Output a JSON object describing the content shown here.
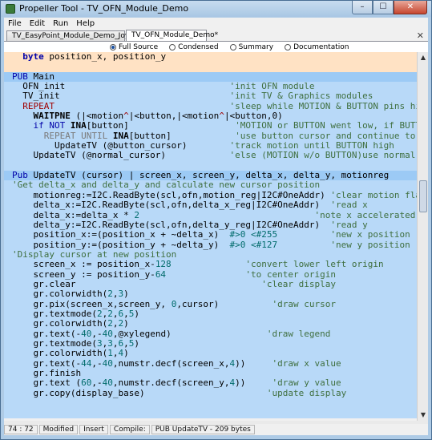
{
  "window": {
    "title": "Propeller Tool - TV_OFN_Module_Demo"
  },
  "caption_buttons": {
    "minimize": "–",
    "maximize": "☐",
    "close": "✕"
  },
  "menu": [
    "File",
    "Edit",
    "Run",
    "Help"
  ],
  "tabs": [
    {
      "label": "TV_EasyPoint_Module_Demo_Joystick"
    },
    {
      "label": "TV_OFN_Module_Demo*"
    }
  ],
  "tab_close": "✕",
  "view_modes": [
    "Full Source",
    "Condensed",
    "Summary",
    "Documentation"
  ],
  "selected_view": "Full Source",
  "code": [
    {
      "bg": "var",
      "parts": [
        [
          "",
          "  "
        ],
        [
          "kw bold",
          "byte"
        ],
        [
          "",
          " position_x, position_y"
        ]
      ]
    },
    {
      "bg": "var",
      "parts": [
        [
          "",
          ""
        ]
      ]
    },
    {
      "bg": "pubh",
      "parts": [
        [
          "kw",
          "PUB"
        ],
        [
          "",
          " Main"
        ]
      ]
    },
    {
      "bg": "pub",
      "parts": [
        [
          "",
          "  OFN_init                               "
        ],
        [
          "c",
          "'init OFN module"
        ]
      ]
    },
    {
      "bg": "pub",
      "parts": [
        [
          "",
          "  TV_init                                "
        ],
        [
          "c",
          "'init TV & Graphics modules"
        ]
      ]
    },
    {
      "bg": "pub",
      "parts": [
        [
          "rd",
          "  REPEAT"
        ],
        [
          "",
          "                                 "
        ],
        [
          "c",
          "'sleep while MOTION & BUTTON pins high"
        ]
      ]
    },
    {
      "bg": "pub",
      "parts": [
        [
          "",
          "    "
        ],
        [
          "bold",
          "WAITPNE"
        ],
        [
          "",
          " (|<motion"
        ],
        [
          "rd",
          "^"
        ],
        [
          "",
          "|<button,|<motion"
        ],
        [
          "rd",
          "^"
        ],
        [
          "",
          "|<button,0)"
        ]
      ]
    },
    {
      "bg": "pub",
      "parts": [
        [
          "",
          "    "
        ],
        [
          "kw",
          "if NOT"
        ],
        [
          "",
          " "
        ],
        [
          "bold",
          "INA"
        ],
        [
          "",
          "[button]                    "
        ],
        [
          "c",
          "'MOTION or BUTTON went low, if BUTTON,"
        ]
      ]
    },
    {
      "bg": "pub",
      "parts": [
        [
          "",
          "      "
        ],
        [
          "gray",
          "REPEAT UNTIL"
        ],
        [
          "",
          " "
        ],
        [
          "bold",
          "INA"
        ],
        [
          "",
          "[button]            "
        ],
        [
          "c",
          "'use button cursor and continue to"
        ]
      ]
    },
    {
      "bg": "pub",
      "parts": [
        [
          "",
          "        UpdateTV (@button_cursor)        "
        ],
        [
          "c",
          "'track motion until BUTTON high"
        ]
      ]
    },
    {
      "bg": "pub",
      "parts": [
        [
          "",
          "    UpdateTV (@normal_cursor)            "
        ],
        [
          "c",
          "'else (MOTION w/o BUTTON)use normal cursor"
        ]
      ]
    },
    {
      "bg": "pub",
      "parts": [
        [
          "",
          ""
        ]
      ]
    },
    {
      "bg": "pubh",
      "parts": [
        [
          "kw",
          "Pub"
        ],
        [
          "",
          " UpdateTV (cursor) | screen_x, screen_y, delta_x, delta_y, motionreg"
        ]
      ]
    },
    {
      "bg": "pub",
      "parts": [
        [
          "c",
          "'Get delta_x and delta_y and calculate new cursor position"
        ]
      ]
    },
    {
      "bg": "pub",
      "parts": [
        [
          "",
          "    motionreg:=I2C.ReadByte(scl,ofn,motion_reg|I2C#OneAddr) "
        ],
        [
          "c",
          "'clear motion flag"
        ]
      ]
    },
    {
      "bg": "pub",
      "parts": [
        [
          "",
          "    delta_x:=I2C.ReadByte(scl,ofn,delta_x_reg|I2C#OneAddr)  "
        ],
        [
          "c",
          "'read x"
        ]
      ]
    },
    {
      "bg": "pub",
      "parts": [
        [
          "",
          "    delta_x:=delta_x * "
        ],
        [
          "num",
          "2"
        ],
        [
          "",
          "                                 "
        ],
        [
          "c",
          "'note x accelerated"
        ]
      ]
    },
    {
      "bg": "pub",
      "parts": [
        [
          "",
          "    delta_y:=I2C.ReadByte(scl,ofn,delta_y_reg|I2C#OneAddr)  "
        ],
        [
          "c",
          "'read y"
        ]
      ]
    },
    {
      "bg": "pub",
      "parts": [
        [
          "",
          "    position_x:=(position_x + ~delta_x)  "
        ],
        [
          "num",
          "#>0 <#255"
        ],
        [
          "",
          "          "
        ],
        [
          "c",
          "'new x position"
        ]
      ]
    },
    {
      "bg": "pub",
      "parts": [
        [
          "",
          "    position_y:=(position_y + ~delta_y)  "
        ],
        [
          "num",
          "#>0 <#127"
        ],
        [
          "",
          "          "
        ],
        [
          "c",
          "'new y position"
        ]
      ]
    },
    {
      "bg": "pub",
      "parts": [
        [
          "c",
          "'Display cursor at new position"
        ]
      ]
    },
    {
      "bg": "pub",
      "parts": [
        [
          "",
          "    screen_x := position_x-"
        ],
        [
          "num",
          "128"
        ],
        [
          "",
          "              "
        ],
        [
          "c",
          "'convert lower left origin"
        ]
      ]
    },
    {
      "bg": "pub",
      "parts": [
        [
          "",
          "    screen_y := position_y-"
        ],
        [
          "num",
          "64"
        ],
        [
          "",
          "               "
        ],
        [
          "c",
          "'to center origin"
        ]
      ]
    },
    {
      "bg": "pub",
      "parts": [
        [
          "",
          "    gr.clear                                   "
        ],
        [
          "c",
          "'clear display"
        ]
      ]
    },
    {
      "bg": "pub",
      "parts": [
        [
          "",
          "    gr.colorwidth("
        ],
        [
          "num",
          "2"
        ],
        [
          "",
          ","
        ],
        [
          "num",
          "3"
        ],
        [
          "",
          ")"
        ]
      ]
    },
    {
      "bg": "pub",
      "parts": [
        [
          "",
          "    gr.pix(screen_x,screen_y, "
        ],
        [
          "num",
          "0"
        ],
        [
          "",
          ",cursor)          "
        ],
        [
          "c",
          "'draw cursor"
        ]
      ]
    },
    {
      "bg": "pub",
      "parts": [
        [
          "",
          "    gr.textmode("
        ],
        [
          "num",
          "2"
        ],
        [
          "",
          ","
        ],
        [
          "num",
          "2"
        ],
        [
          "",
          ","
        ],
        [
          "num",
          "6"
        ],
        [
          "",
          ","
        ],
        [
          "num",
          "5"
        ],
        [
          "",
          ")"
        ]
      ]
    },
    {
      "bg": "pub",
      "parts": [
        [
          "",
          "    gr.colorwidth("
        ],
        [
          "num",
          "2"
        ],
        [
          "",
          ","
        ],
        [
          "num",
          "2"
        ],
        [
          "",
          ")"
        ]
      ]
    },
    {
      "bg": "pub",
      "parts": [
        [
          "",
          "    gr.text(-"
        ],
        [
          "num",
          "40"
        ],
        [
          "",
          ",-"
        ],
        [
          "num",
          "40"
        ],
        [
          "",
          ",@xylegend)                  "
        ],
        [
          "c",
          "'draw legend"
        ]
      ]
    },
    {
      "bg": "pub",
      "parts": [
        [
          "",
          "    gr.textmode("
        ],
        [
          "num",
          "3"
        ],
        [
          "",
          ","
        ],
        [
          "num",
          "3"
        ],
        [
          "",
          ","
        ],
        [
          "num",
          "6"
        ],
        [
          "",
          ","
        ],
        [
          "num",
          "5"
        ],
        [
          "",
          ")"
        ]
      ]
    },
    {
      "bg": "pub",
      "parts": [
        [
          "",
          "    gr.colorwidth("
        ],
        [
          "num",
          "1"
        ],
        [
          "",
          ","
        ],
        [
          "num",
          "4"
        ],
        [
          "",
          ")"
        ]
      ]
    },
    {
      "bg": "pub",
      "parts": [
        [
          "",
          "    gr.text(-"
        ],
        [
          "num",
          "44"
        ],
        [
          "",
          ",-"
        ],
        [
          "num",
          "40"
        ],
        [
          "",
          ",numstr.decf(screen_x,"
        ],
        [
          "num",
          "4"
        ],
        [
          "",
          "))     "
        ],
        [
          "c",
          "'draw x value"
        ]
      ]
    },
    {
      "bg": "pub",
      "parts": [
        [
          "",
          "    gr.finish"
        ]
      ]
    },
    {
      "bg": "pub",
      "parts": [
        [
          "",
          "    gr.text ("
        ],
        [
          "num",
          "60"
        ],
        [
          "",
          ",-"
        ],
        [
          "num",
          "40"
        ],
        [
          "",
          ",numstr.decf(screen_y,"
        ],
        [
          "num",
          "4"
        ],
        [
          "",
          "))     "
        ],
        [
          "c",
          "'draw y value"
        ]
      ]
    },
    {
      "bg": "pub",
      "parts": [
        [
          "",
          "    gr.copy(display_base)                       "
        ],
        [
          "c",
          "'update display"
        ]
      ]
    },
    {
      "bg": "pub",
      "parts": [
        [
          "",
          ""
        ]
      ]
    },
    {
      "bg": "pub",
      "parts": [
        [
          "",
          ""
        ]
      ]
    }
  ],
  "status": {
    "position": "74 : 72",
    "modified": "Modified",
    "insert": "Insert",
    "compile": "Compile:",
    "context": "PUB UpdateTV - 209 bytes"
  }
}
